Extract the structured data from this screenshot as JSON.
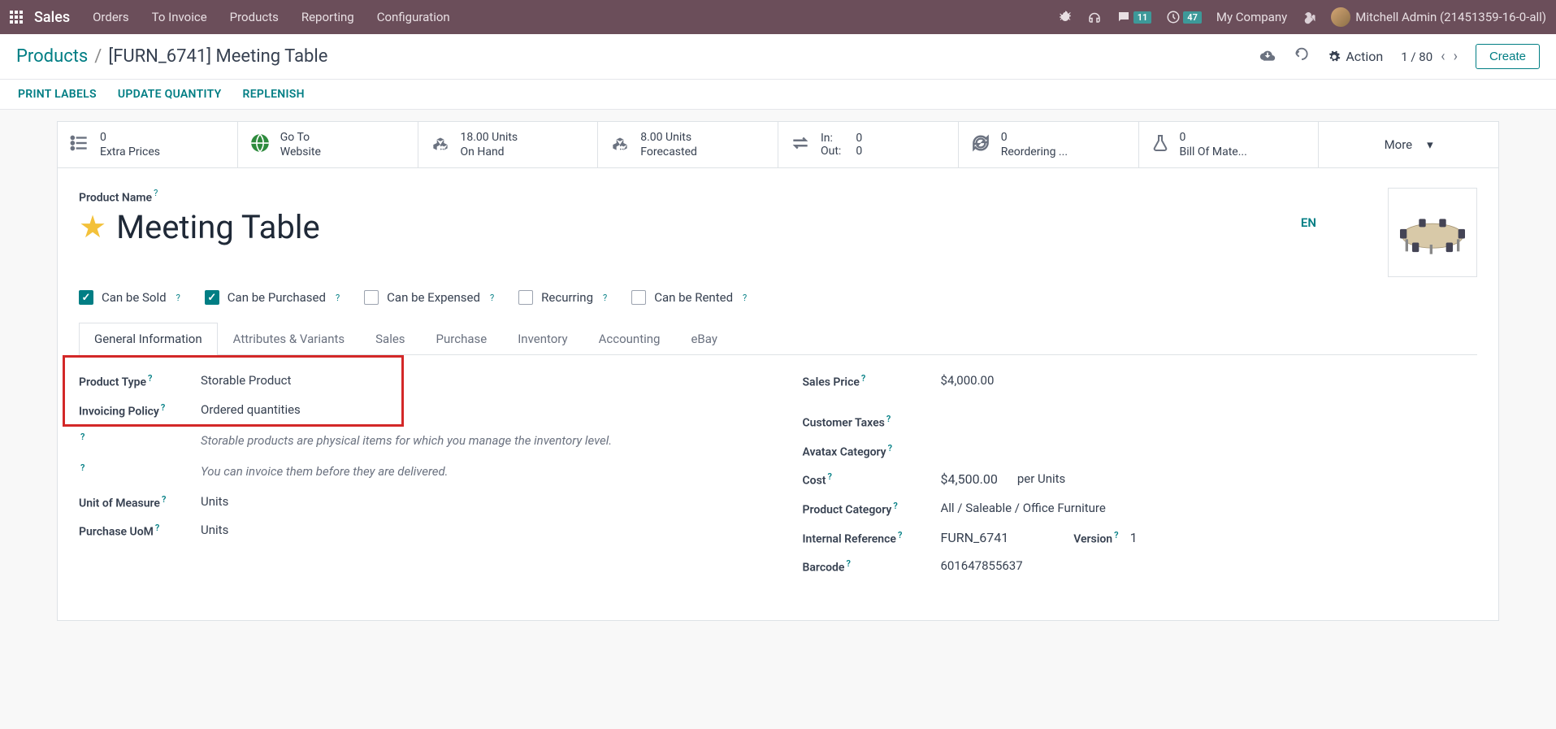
{
  "nav": {
    "brand": "Sales",
    "menu": [
      "Orders",
      "To Invoice",
      "Products",
      "Reporting",
      "Configuration"
    ],
    "chat_badge": "11",
    "clock_badge": "47",
    "company": "My Company",
    "user": "Mitchell Admin (21451359-16-0-all)"
  },
  "header": {
    "breadcrumb_link": "Products",
    "breadcrumb_current": "[FURN_6741] Meeting Table",
    "action_label": "Action",
    "pager": "1 / 80",
    "create": "Create"
  },
  "subheader": {
    "print": "PRINT LABELS",
    "update": "UPDATE QUANTITY",
    "replenish": "REPLENISH"
  },
  "stats": {
    "extra_val": "0",
    "extra_lbl": "Extra Prices",
    "web_lbl1": "Go To",
    "web_lbl2": "Website",
    "onhand_val": "18.00 Units",
    "onhand_lbl": "On Hand",
    "fore_val": "8.00 Units",
    "fore_lbl": "Forecasted",
    "in_lbl": "In:",
    "in_val": "0",
    "out_lbl": "Out:",
    "out_val": "0",
    "reo_val": "0",
    "reo_lbl": "Reordering ...",
    "bom_val": "0",
    "bom_lbl": "Bill Of Mate...",
    "more": "More"
  },
  "product": {
    "name_label": "Product Name",
    "title": "Meeting Table",
    "lang": "EN"
  },
  "checks": {
    "sold": "Can be Sold",
    "purchased": "Can be Purchased",
    "expensed": "Can be Expensed",
    "recurring": "Recurring",
    "rented": "Can be Rented"
  },
  "tabs": [
    "General Information",
    "Attributes & Variants",
    "Sales",
    "Purchase",
    "Inventory",
    "Accounting",
    "eBay"
  ],
  "fields": {
    "product_type_lbl": "Product Type",
    "product_type_val": "Storable Product",
    "invoicing_lbl": "Invoicing Policy",
    "invoicing_val": "Ordered quantities",
    "help1": "Storable products are physical items for which you manage the inventory level.",
    "help2": "You can invoice them before they are delivered.",
    "uom_lbl": "Unit of Measure",
    "uom_val": "Units",
    "puom_lbl": "Purchase UoM",
    "puom_val": "Units",
    "price_lbl": "Sales Price",
    "price_val": "$4,000.00",
    "taxes_lbl": "Customer Taxes",
    "avatax_lbl": "Avatax Category",
    "cost_lbl": "Cost",
    "cost_val": "$4,500.00",
    "cost_per": "per Units",
    "cat_lbl": "Product Category",
    "cat_val": "All / Saleable / Office Furniture",
    "ref_lbl": "Internal Reference",
    "ref_val": "FURN_6741",
    "version_lbl": "Version",
    "version_val": "1",
    "barcode_lbl": "Barcode",
    "barcode_val": "601647855637"
  }
}
